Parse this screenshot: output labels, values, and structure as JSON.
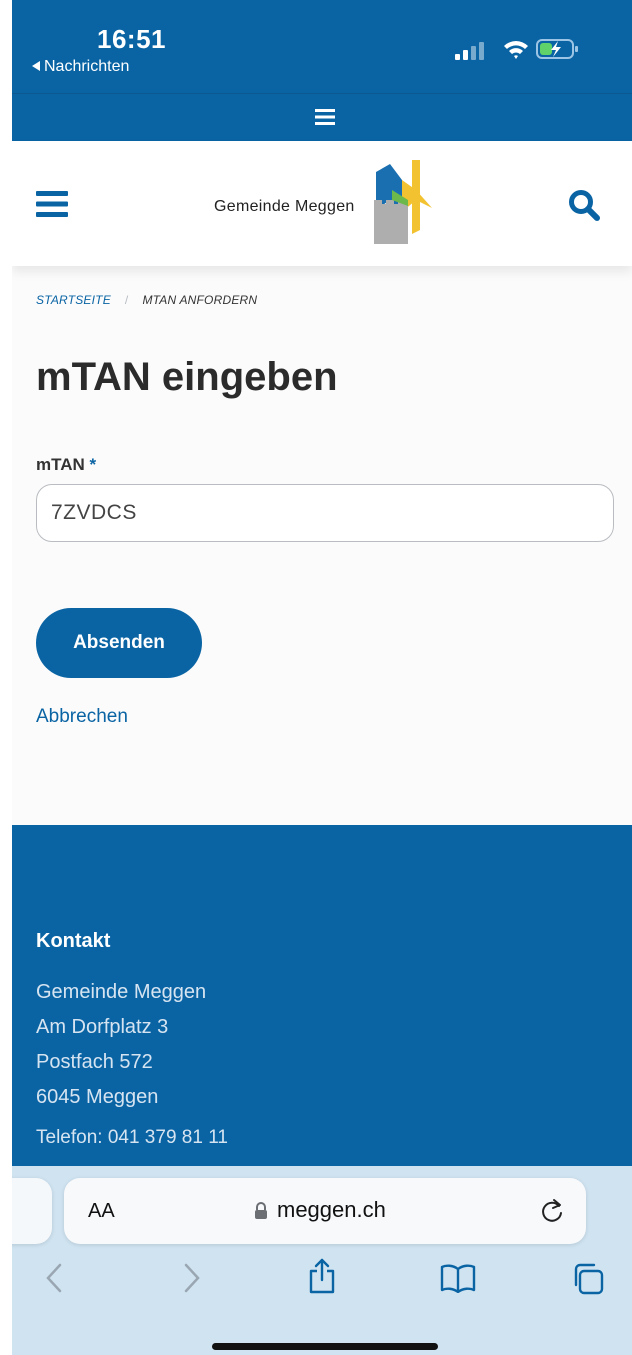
{
  "status_bar": {
    "time": "16:51",
    "back_label": "Nachrichten"
  },
  "header": {
    "site_name": "Gemeinde Meggen"
  },
  "breadcrumb": {
    "home": "STARTSEITE",
    "separator": "/",
    "current": "MTAN ANFORDERN"
  },
  "main": {
    "title": "mTAN eingeben",
    "field_label": "mTAN",
    "required_mark": "*",
    "field_value": "7ZVDCS",
    "submit_label": "Absenden",
    "cancel_label": "Abbrechen"
  },
  "footer": {
    "heading": "Kontakt",
    "address_lines": [
      "Gemeinde Meggen",
      "Am Dorfplatz 3",
      "Postfach 572",
      "6045 Meggen"
    ],
    "phone": "Telefon: 041 379 81 11"
  },
  "browser": {
    "text_size_label": "AA",
    "url": "meggen.ch"
  },
  "colors": {
    "brand_blue": "#0a64a4",
    "toolbar_bg": "#cfe3f1"
  },
  "icons": [
    "signal-icon",
    "wifi-icon",
    "battery-charging-icon",
    "hamburger-icon",
    "search-icon",
    "lock-icon",
    "reload-icon",
    "back-arrow-icon",
    "forward-arrow-icon",
    "share-icon",
    "bookmarks-icon",
    "tabs-icon"
  ]
}
